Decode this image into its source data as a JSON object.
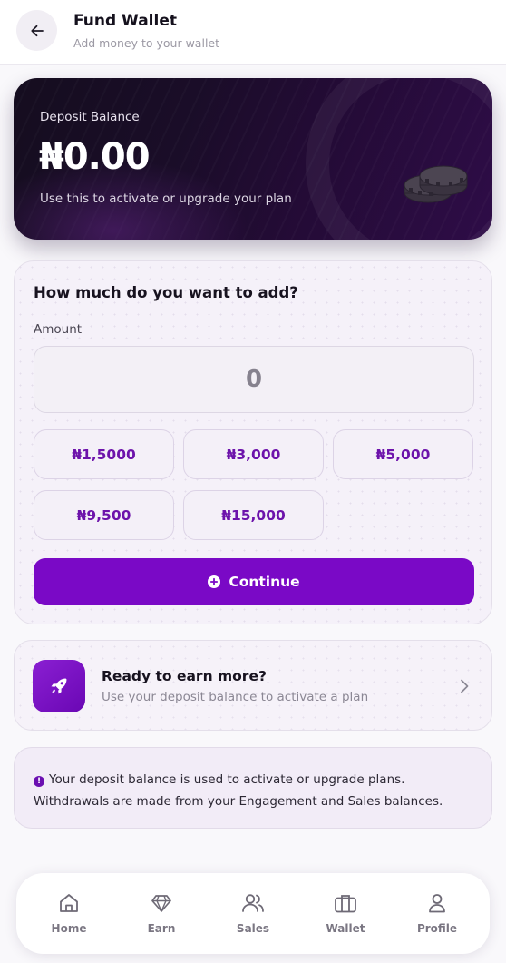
{
  "header": {
    "title": "Fund Wallet",
    "subtitle": "Add money to your wallet",
    "back_icon": "arrow-left-icon"
  },
  "balance_card": {
    "label": "Deposit Balance",
    "amount": "₦0.00",
    "note": "Use this to activate or upgrade your plan",
    "icon": "coins-icon"
  },
  "amount_form": {
    "title": "How much do you want to add?",
    "amount_label": "Amount",
    "input_placeholder": "0",
    "input_value": "",
    "presets": [
      "₦1,5000",
      "₦3,000",
      "₦5,000",
      "₦9,500",
      "₦15,000"
    ],
    "continue_label": "Continue",
    "continue_icon": "plus-circle-icon"
  },
  "earn_card": {
    "title": "Ready to earn more?",
    "subtitle": "Use your deposit balance to activate a plan",
    "icon": "rocket-icon"
  },
  "info": {
    "text": "Your deposit balance is used to activate or upgrade plans. Withdrawals are made from your Engagement and Sales balances.",
    "icon": "info-icon"
  },
  "nav": {
    "items": [
      {
        "label": "Home",
        "icon": "home-icon"
      },
      {
        "label": "Earn",
        "icon": "diamond-icon"
      },
      {
        "label": "Sales",
        "icon": "users-icon"
      },
      {
        "label": "Wallet",
        "icon": "briefcase-icon"
      },
      {
        "label": "Profile",
        "icon": "user-icon"
      }
    ]
  },
  "colors": {
    "accent": "#7a09c6",
    "preset_text": "#6d13ab",
    "card_dark": "#1a0d28"
  }
}
